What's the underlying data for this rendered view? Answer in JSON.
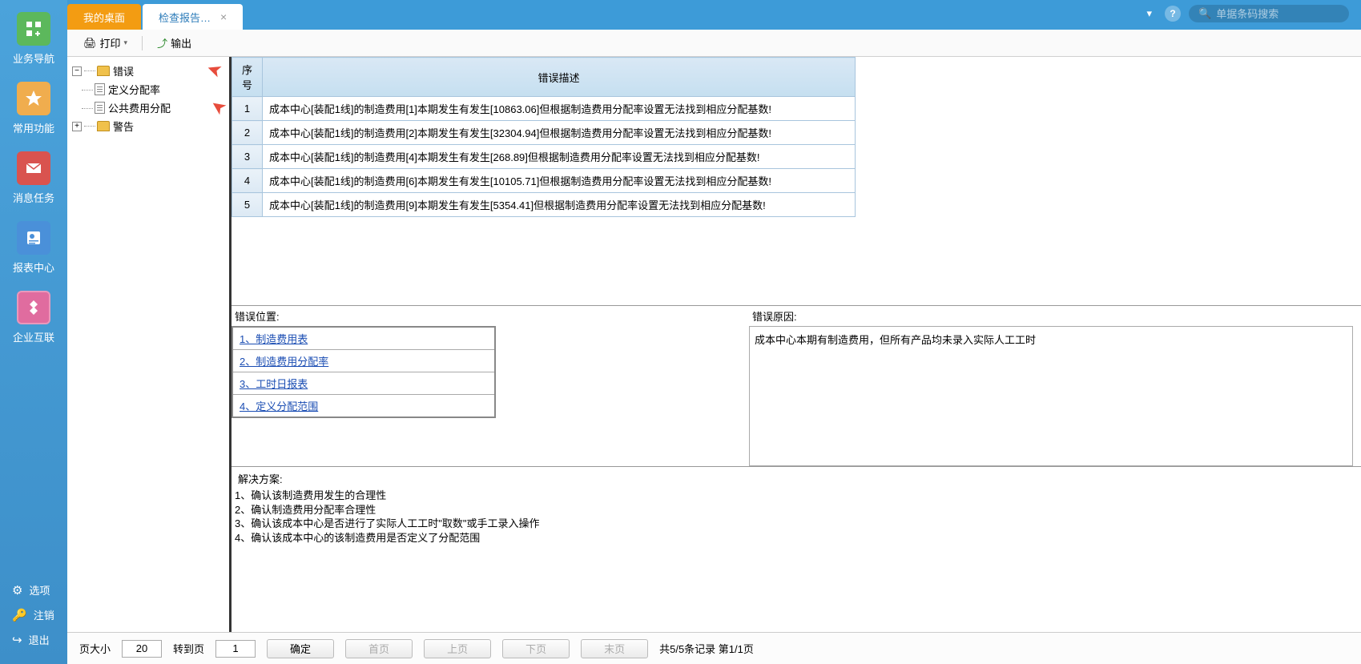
{
  "sidebar": {
    "items": [
      {
        "label": "业务导航"
      },
      {
        "label": "常用功能"
      },
      {
        "label": "消息任务"
      },
      {
        "label": "报表中心"
      },
      {
        "label": "企业互联"
      }
    ],
    "bottom": [
      {
        "label": "选项"
      },
      {
        "label": "注销"
      },
      {
        "label": "退出"
      }
    ]
  },
  "tabs": {
    "t0": "我的桌面",
    "t1": "检查报告…"
  },
  "search": {
    "placeholder": "单据条码搜索"
  },
  "toolbar": {
    "print": "打印",
    "export": "输出"
  },
  "tree": {
    "error": "错误",
    "child1": "定义分配率",
    "child2": "公共费用分配",
    "warn": "警告"
  },
  "table": {
    "col_seq": "序号",
    "col_desc": "错误描述",
    "rows": [
      {
        "n": "1",
        "d": "成本中心[装配1线]的制造费用[1]本期发生有发生[10863.06]但根据制造费用分配率设置无法找到相应分配基数!"
      },
      {
        "n": "2",
        "d": "成本中心[装配1线]的制造费用[2]本期发生有发生[32304.94]但根据制造费用分配率设置无法找到相应分配基数!"
      },
      {
        "n": "3",
        "d": "成本中心[装配1线]的制造费用[4]本期发生有发生[268.89]但根据制造费用分配率设置无法找到相应分配基数!"
      },
      {
        "n": "4",
        "d": "成本中心[装配1线]的制造费用[6]本期发生有发生[10105.71]但根据制造费用分配率设置无法找到相应分配基数!"
      },
      {
        "n": "5",
        "d": "成本中心[装配1线]的制造费用[9]本期发生有发生[5354.41]但根据制造费用分配率设置无法找到相应分配基数!"
      }
    ]
  },
  "location": {
    "label": "错误位置:",
    "items": [
      "1、制造费用表",
      "2、制造费用分配率",
      "3、工时日报表",
      "4、定义分配范围"
    ]
  },
  "reason": {
    "label": "错误原因:",
    "text": "成本中心本期有制造费用，但所有产品均未录入实际人工工时"
  },
  "solution": {
    "label": "解决方案:",
    "lines": [
      "1、确认该制造费用发生的合理性",
      "2、确认制造费用分配率合理性",
      "3、确认该成本中心是否进行了实际人工工时\"取数\"或手工录入操作",
      "4、确认该成本中心的该制造费用是否定义了分配范围"
    ]
  },
  "pager": {
    "page_size_label": "页大小",
    "page_size": "20",
    "goto_label": "转到页",
    "goto": "1",
    "confirm": "确定",
    "first": "首页",
    "prev": "上页",
    "next": "下页",
    "last": "末页",
    "info": "共5/5条记录 第1/1页"
  }
}
